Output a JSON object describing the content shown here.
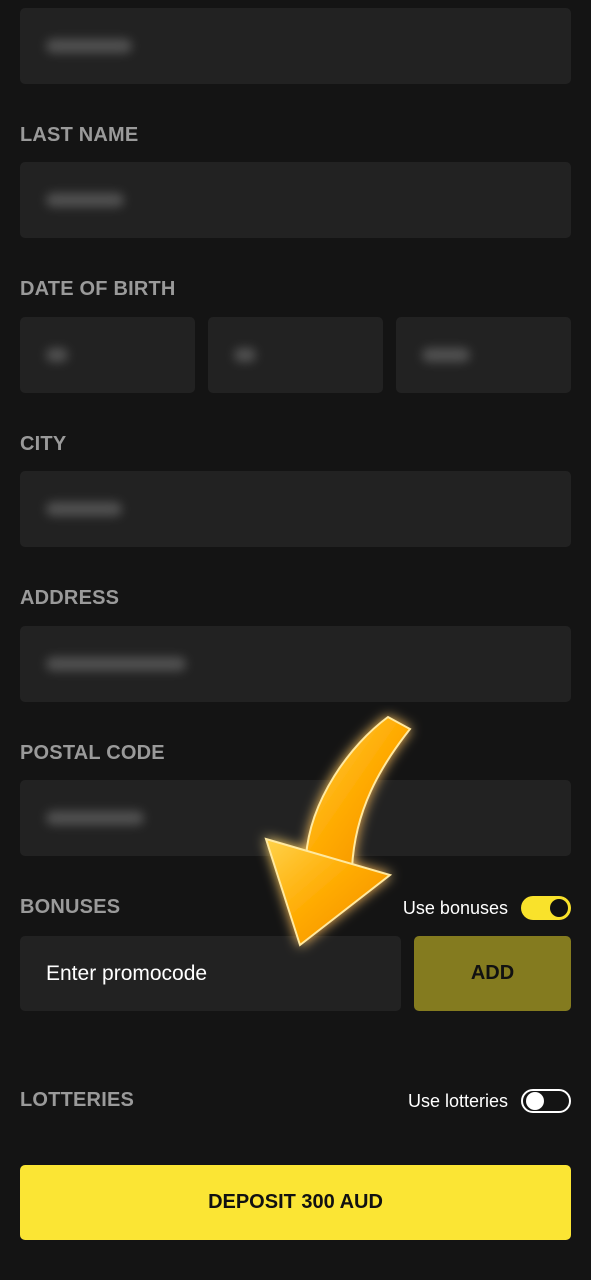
{
  "form": {
    "last_name_label": "LAST NAME",
    "dob_label": "DATE OF BIRTH",
    "city_label": "CITY",
    "address_label": "ADDRESS",
    "postal_code_label": "POSTAL CODE"
  },
  "bonuses": {
    "label": "BONUSES",
    "toggle_label": "Use bonuses",
    "toggle_on": true,
    "promo_placeholder": "Enter promocode",
    "add_label": "ADD"
  },
  "lotteries": {
    "label": "LOTTERIES",
    "toggle_label": "Use lotteries",
    "toggle_on": false
  },
  "deposit_label": "DEPOSIT 300 AUD",
  "colors": {
    "background": "#141414",
    "field": "#222222",
    "accent": "#fbe534",
    "add_button": "#847b1f",
    "arrow": "#f5a300"
  },
  "icons": [
    "curved-arrow-icon",
    "toggle-switch"
  ]
}
